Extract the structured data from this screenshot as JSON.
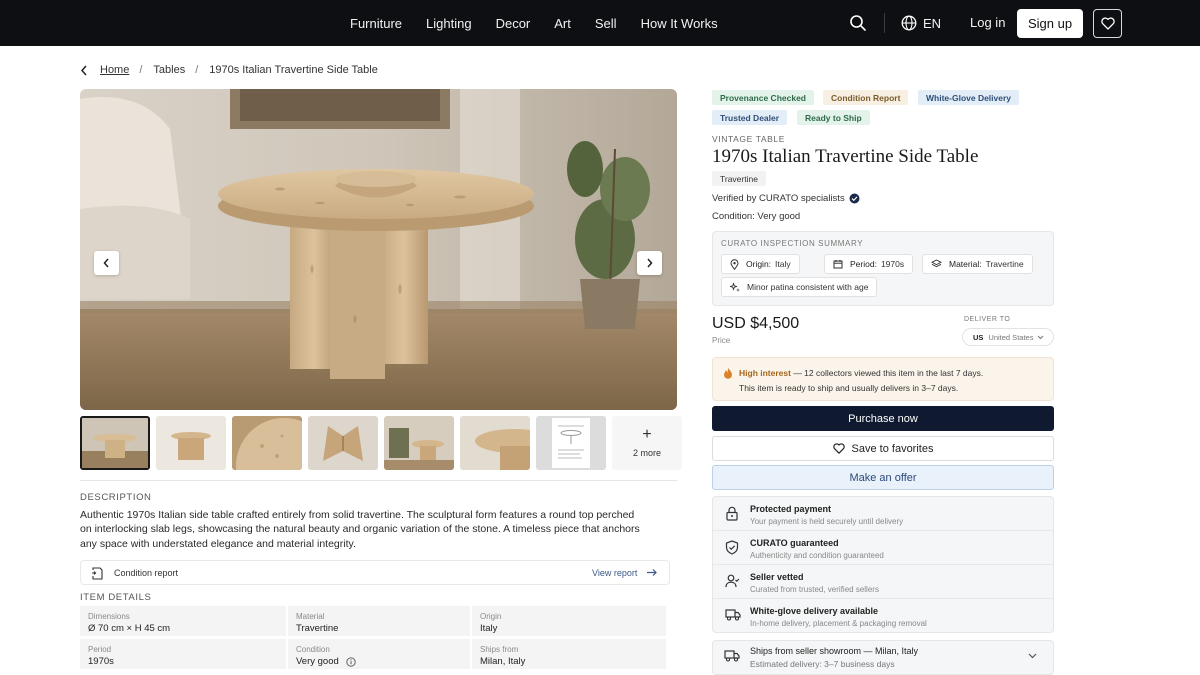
{
  "nav": {
    "links": [
      "Furniture",
      "Lighting",
      "Decor",
      "Art",
      "Sell",
      "How It Works"
    ],
    "lang": "EN",
    "login": "Log in",
    "signup": "Sign up"
  },
  "breadcrumb": [
    "Home",
    "Tables",
    "1970s Italian Travertine Side Table"
  ],
  "gallery": {
    "more_label": "2 more"
  },
  "description": {
    "heading": "DESCRIPTION",
    "lines": [
      "Authentic 1970s Italian side table crafted entirely from solid travertine. The sculptural form features a round top perched",
      "on interlocking slab legs, showcasing the natural beauty and organic variation of the stone. A timeless piece that anchors",
      "any space with understated elegance and material integrity."
    ]
  },
  "condition_report": {
    "label": "Condition report",
    "link": "View report"
  },
  "item_details": {
    "heading": "ITEM DETAILS",
    "cells": [
      {
        "key": "Dimensions",
        "value": "Ø 70 cm × H 45 cm"
      },
      {
        "key": "Material",
        "value": "Travertine"
      },
      {
        "key": "Origin",
        "value": "Italy"
      },
      {
        "key": "Period",
        "value": "1970s"
      },
      {
        "key": "Condition",
        "value": "Very good"
      },
      {
        "key": "Ships from",
        "value": "Milan, Italy"
      }
    ]
  },
  "badges": [
    "Provenance Checked",
    "Condition Report",
    "White-Glove Delivery",
    "Trusted Dealer",
    "Ready to Ship"
  ],
  "product": {
    "kicker": "VINTAGE TABLE",
    "title": "1970s Italian Travertine Side Table",
    "material_chip": "Travertine",
    "verified": "Verified by CURATO specialists",
    "condition": "Condition: Very good"
  },
  "inspection": {
    "heading": "CURATO INSPECTION SUMMARY",
    "origin_k": "Origin:",
    "origin_v": "Italy",
    "period_k": "Period:",
    "period_v": "1970s",
    "material_k": "Material:",
    "material_v": "Travertine",
    "note": "Minor patina consistent with age"
  },
  "pricing": {
    "price": "USD $4,500",
    "price_label": "Price",
    "deliver_label": "DELIVER TO",
    "country_code": "US",
    "country": "United States"
  },
  "interest": {
    "highlight": "High interest",
    "line1_rest": " — 12 collectors viewed this item in the last 7 days.",
    "line2": "This item is ready to ship and usually delivers in 3–7 days."
  },
  "actions": {
    "purchase": "Purchase now",
    "favorites": "Save to favorites",
    "offer": "Make an offer"
  },
  "trust": [
    {
      "title": "Protected payment",
      "sub": "Your payment is held securely until delivery"
    },
    {
      "title": "CURATO guaranteed",
      "sub": "Authenticity and condition guaranteed"
    },
    {
      "title": "Seller vetted",
      "sub": "Curated from trusted, verified sellers"
    },
    {
      "title": "White-glove delivery available",
      "sub": "In-home delivery, placement & packaging removal"
    }
  ],
  "shipping": {
    "title": "Ships from seller showroom — Milan, Italy",
    "sub": "Estimated delivery: 3–7 business days"
  }
}
